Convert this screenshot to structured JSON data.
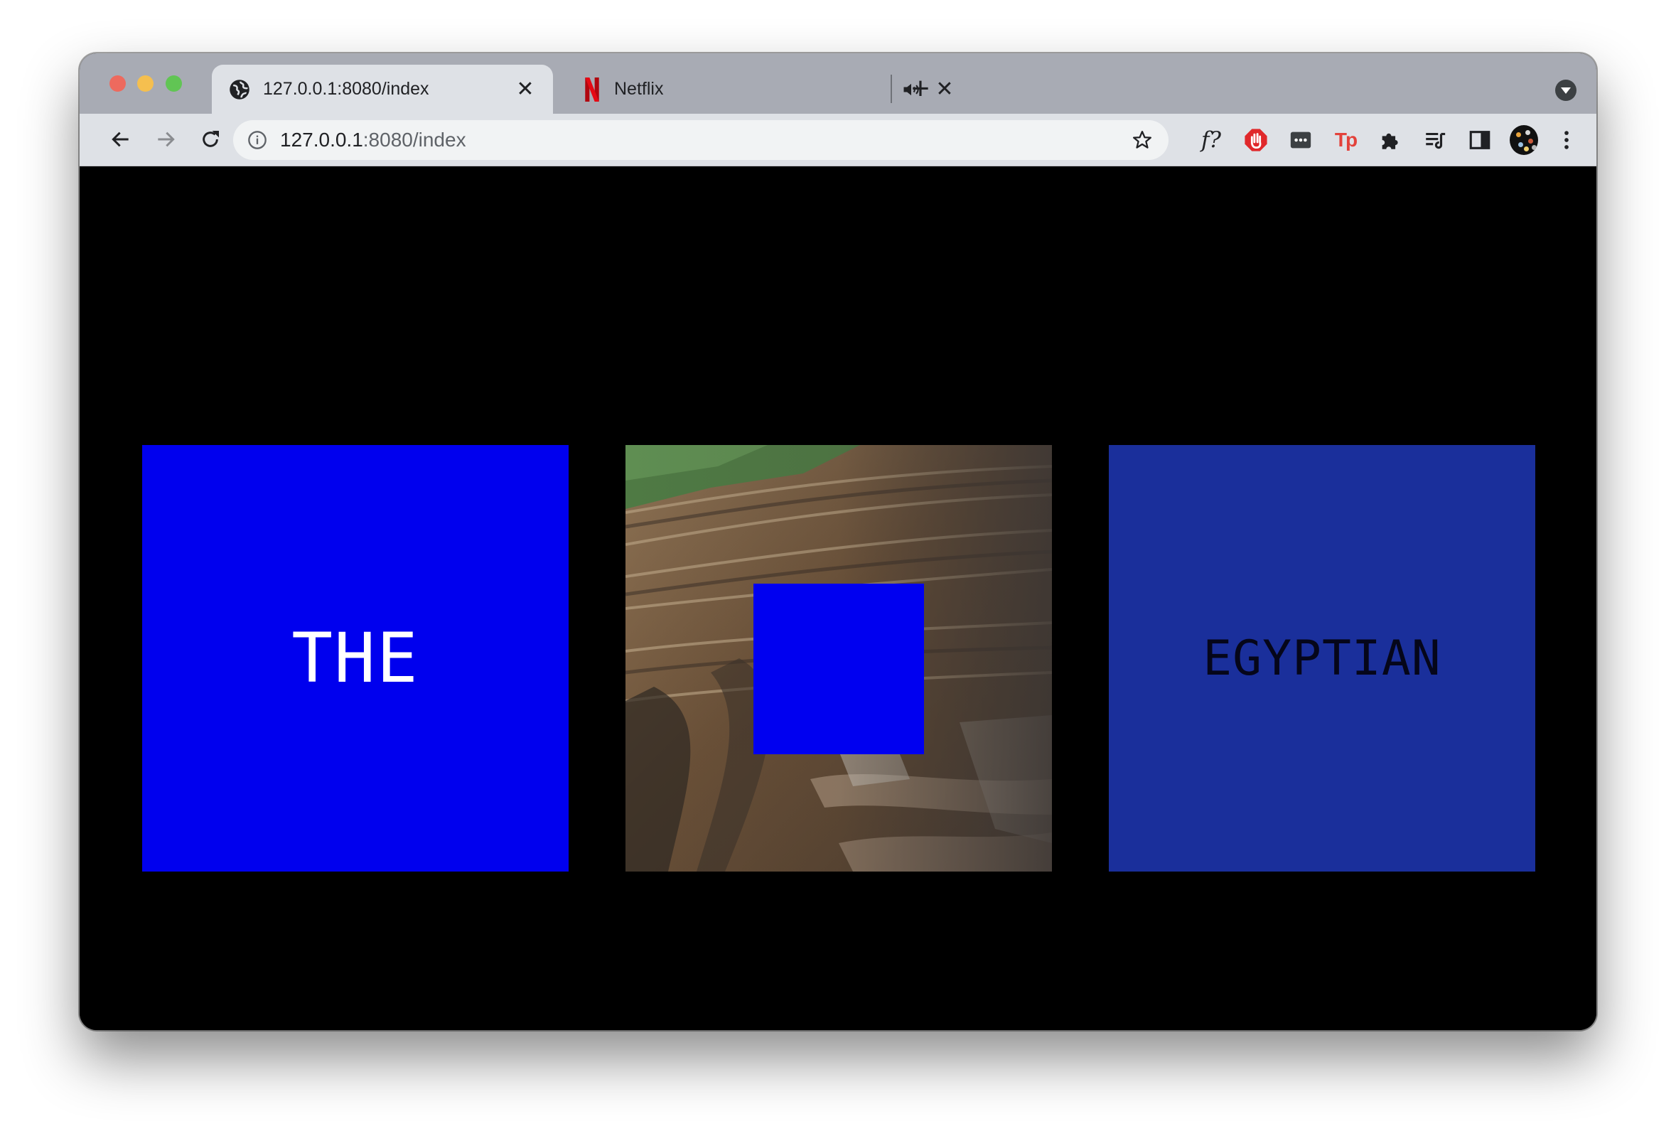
{
  "browser": {
    "tabs": [
      {
        "title": "127.0.0.1:8080/index",
        "active": true,
        "icon": "globe-icon"
      },
      {
        "title": "Netflix",
        "active": false,
        "icon": "netflix-icon",
        "audio": true
      }
    ],
    "address": {
      "host": "127.0.0.1",
      "rest": ":8080/index"
    },
    "extensions": [
      {
        "name": "fonts-ninja-extension",
        "label": "f?"
      },
      {
        "name": "adblock-extension"
      },
      {
        "name": "dots-extension"
      },
      {
        "name": "tp-extension",
        "label": "Tp"
      },
      {
        "name": "puzzle-extensions-icon"
      },
      {
        "name": "media-control-icon"
      },
      {
        "name": "side-panel-icon"
      }
    ]
  },
  "page": {
    "background": "#000000",
    "panels": {
      "left": {
        "word": "THE",
        "color": "#0000ee",
        "text_color": "#ffffff"
      },
      "middle": {
        "image": "open-pit-mine-photo",
        "overlay_color": "#0000f0"
      },
      "right": {
        "word": "EGYPTIAN",
        "color": "#1a2f9b",
        "text_color": "#05061a"
      }
    }
  }
}
